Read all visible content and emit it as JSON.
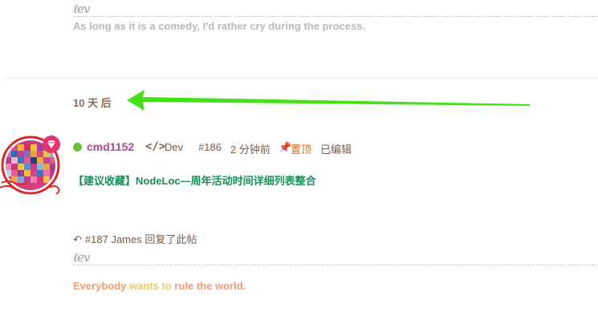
{
  "post185": {
    "signature_icon": "signature-scribble-icon",
    "quote": "As long as it is a comedy, I'd rather cry during the process."
  },
  "time_gap": "10 天 后",
  "annotation": {
    "arrow_icon": "green-arrow-icon",
    "arrow_color": "#44e01a"
  },
  "post186": {
    "avatar_badge_icon": "diamond-badge-icon",
    "status_color": "#6abf3f",
    "username": "cmd1152",
    "role_icon": "code-icon",
    "role": "Dev",
    "post_number": "#186",
    "time_ago": "2 分钟前",
    "pin_icon": "pin-icon",
    "pinned_label": "置顶",
    "edited_label": "已编辑",
    "link_text": "【建议收藏】NodeLoc—周年活动时间详细列表整合"
  },
  "post187": {
    "reply_icon": "reply-arrow-icon",
    "reply_text": "#187 James 回复了此帖",
    "signature_icon": "signature-scribble-icon",
    "quote_parts": [
      "Everybody",
      " wants to ",
      "rule the world."
    ]
  }
}
